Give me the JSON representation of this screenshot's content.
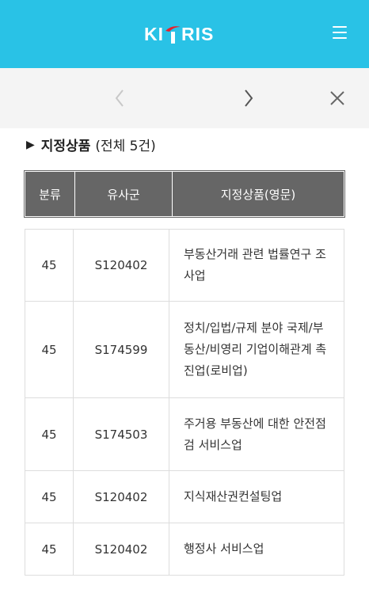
{
  "header": {
    "logo_text_left": "KI",
    "logo_text_right": "RIS"
  },
  "section": {
    "title": "지정상품",
    "count": "(전체 5건)"
  },
  "table": {
    "columns": [
      "분류",
      "유사군",
      "지정상품(영문)"
    ],
    "rows": [
      {
        "cls": "45",
        "group": "S120402",
        "product": "부동산거래 관련 법률연구 조사업"
      },
      {
        "cls": "45",
        "group": "S174599",
        "product": "정치/입법/규제 분야 국제/부동산/비영리 기업이해관계 촉진업(로비업)"
      },
      {
        "cls": "45",
        "group": "S174503",
        "product": "주거용 부동산에 대한 안전점검 서비스업"
      },
      {
        "cls": "45",
        "group": "S120402",
        "product": "지식재산권컨설팅업"
      },
      {
        "cls": "45",
        "group": "S120402",
        "product": "행정사 서비스업"
      }
    ]
  },
  "icons": {
    "menu": "hamburger-icon",
    "prev": "chevron-left-icon",
    "next": "chevron-right-icon",
    "close": "close-icon"
  },
  "colors": {
    "header_bg": "#29c2e6",
    "nav_bg": "#f4f4f4",
    "table_head_bg": "#666666",
    "logo_accent": "#e8212b"
  }
}
